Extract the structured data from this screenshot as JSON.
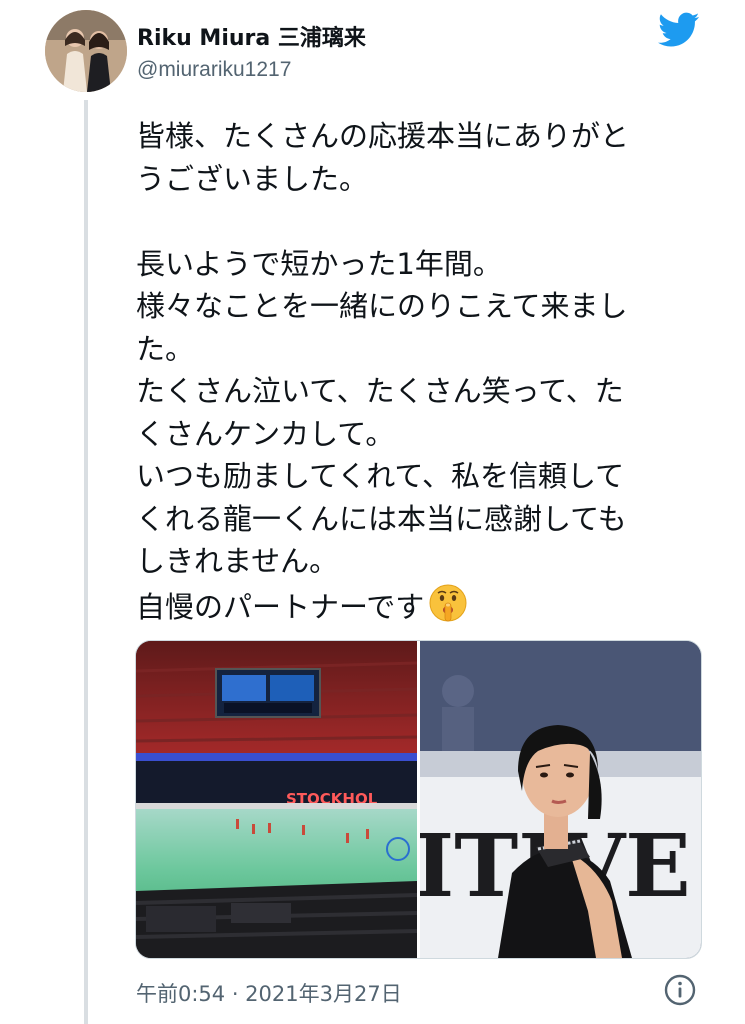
{
  "tweet": {
    "author": {
      "display_name": "Riku Miura 三浦璃来",
      "handle": "@miurariku1217"
    },
    "text_lines": [
      "皆様、たくさんの応援本当にありがと",
      "うございました。",
      "",
      "長いようで短かった1年間。",
      "様々なことを一緒にのりこえて来まし",
      "た。",
      "たくさん泣いて、たくさん笑って、た",
      "くさんケンカして。",
      "いつも励ましてくれて、私を信頼して",
      "くれる龍一くんには本当に感謝しても",
      "しきれません。",
      "自慢のパートナーです"
    ],
    "emoji": "shushing-face-emoji",
    "media": {
      "photo_left": {
        "subject": "arena-scene",
        "board_text": "STOCKHOL"
      },
      "photo_right": {
        "subject": "skater-portrait",
        "board_text": "ITIVE"
      }
    },
    "timestamp": "午前0:54 · 2021年3月27日"
  },
  "colors": {
    "twitter_blue": "#1d9bf0",
    "secondary_text": "#536471",
    "thread_line": "#d9dee2"
  }
}
